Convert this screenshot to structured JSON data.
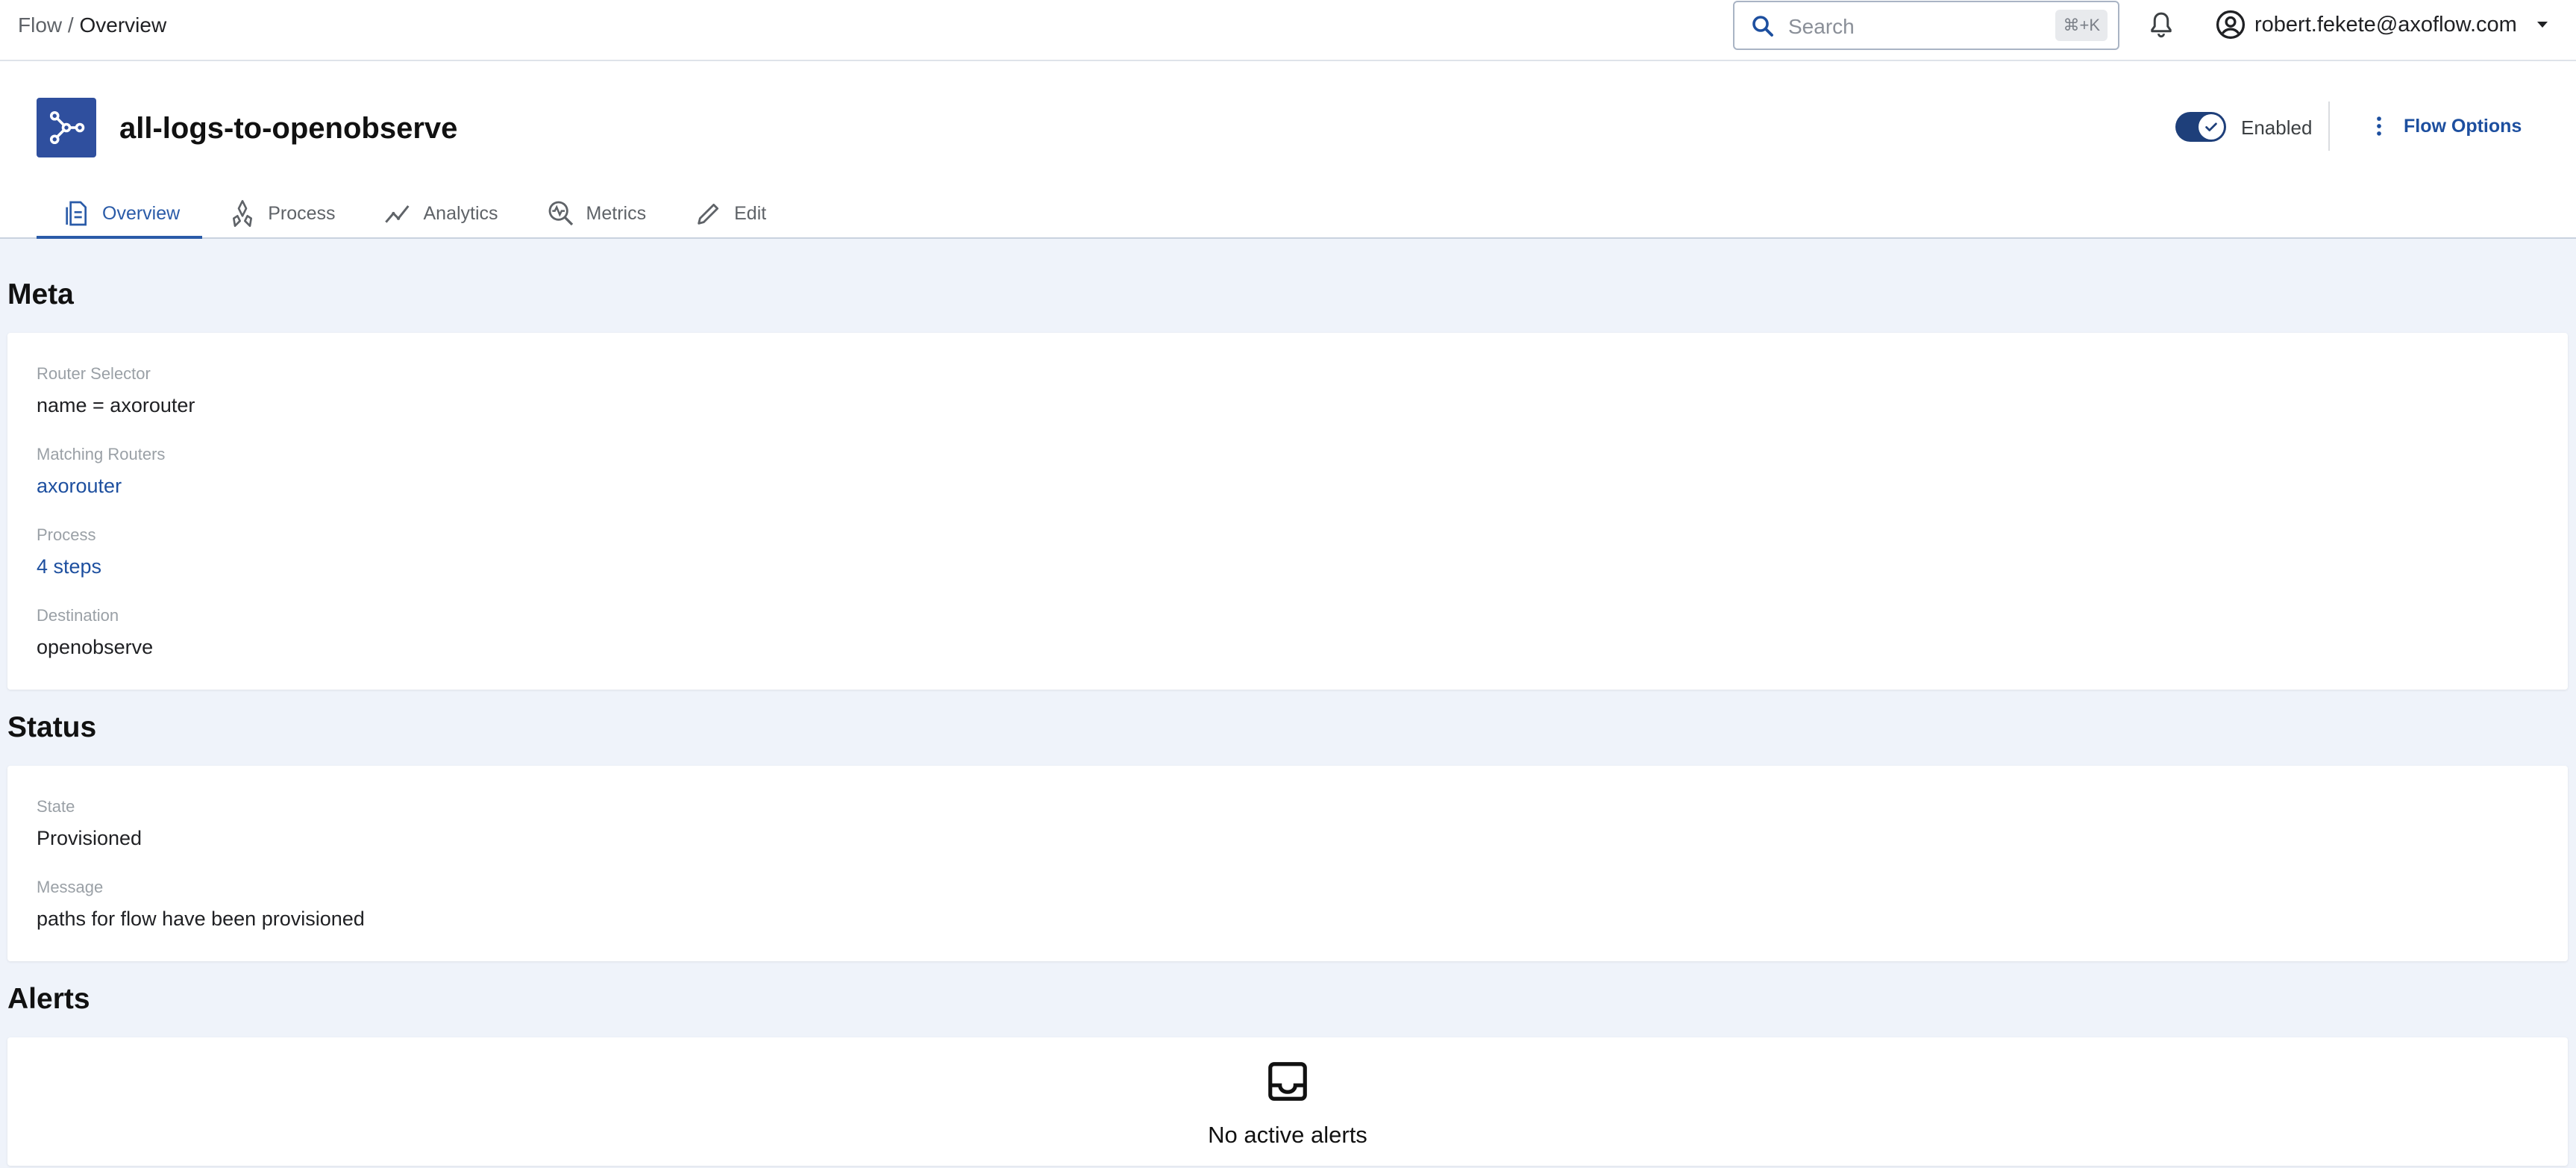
{
  "breadcrumb": {
    "parent": "Flow",
    "separator": "/",
    "current": "Overview"
  },
  "search": {
    "placeholder": "Search",
    "shortcut": "⌘+K"
  },
  "user": {
    "email": "robert.fekete@axoflow.com"
  },
  "flow": {
    "name": "all-logs-to-openobserve",
    "enabled": true,
    "enabled_label": "Enabled",
    "options_label": "Flow Options"
  },
  "tabs": [
    {
      "label": "Overview",
      "icon": "overview-icon",
      "active": true
    },
    {
      "label": "Process",
      "icon": "process-icon",
      "active": false
    },
    {
      "label": "Analytics",
      "icon": "analytics-icon",
      "active": false
    },
    {
      "label": "Metrics",
      "icon": "metrics-icon",
      "active": false
    },
    {
      "label": "Edit",
      "icon": "edit-icon",
      "active": false
    }
  ],
  "meta": {
    "title": "Meta",
    "fields": [
      {
        "label": "Router Selector",
        "value": "name = axorouter",
        "link": false
      },
      {
        "label": "Matching Routers",
        "value": "axorouter",
        "link": true
      },
      {
        "label": "Process",
        "value": "4 steps",
        "link": true
      },
      {
        "label": "Destination",
        "value": "openobserve",
        "link": false
      }
    ]
  },
  "status": {
    "title": "Status",
    "fields": [
      {
        "label": "State",
        "value": "Provisioned"
      },
      {
        "label": "Message",
        "value": "paths for flow have been provisioned"
      }
    ]
  },
  "alerts": {
    "title": "Alerts",
    "empty_text": "No active alerts"
  },
  "colors": {
    "accent": "#2a5ba8",
    "link": "#1d4f9f",
    "logo_bg": "#2f4f9e",
    "toggle_on": "#1e3f7a",
    "page_bg": "#eff3fa"
  }
}
